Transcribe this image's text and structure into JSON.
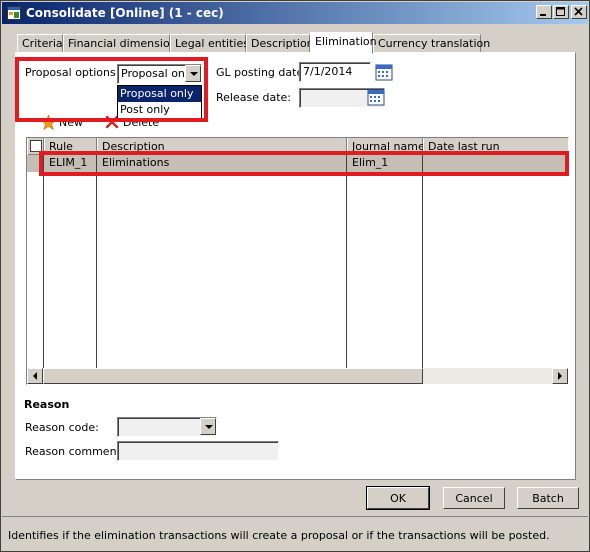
{
  "window": {
    "title": "Consolidate [Online] (1 - cec)",
    "icons": {
      "app": "app-window-icon",
      "minimize": "minimize-icon",
      "maximize": "maximize-icon",
      "close": "close-icon"
    }
  },
  "tabs": [
    {
      "label": "Criteria",
      "active": false
    },
    {
      "label": "Financial dimensions",
      "active": false
    },
    {
      "label": "Legal entities",
      "active": false
    },
    {
      "label": "Description",
      "active": false
    },
    {
      "label": "Elimination",
      "active": true
    },
    {
      "label": "Currency translation",
      "active": false
    }
  ],
  "elimination": {
    "proposal_options_label": "Proposal options:",
    "proposal_options_value": "Proposal only",
    "proposal_options_list": [
      {
        "label": "Proposal only",
        "selected": true
      },
      {
        "label": "Post only",
        "selected": false
      }
    ],
    "gl_posting_date_label": "GL posting date:",
    "gl_posting_date_value": "7/1/2014",
    "release_date_label": "Release date:",
    "release_date_value": ""
  },
  "toolbar": {
    "new_label": "New",
    "delete_label": "Delete"
  },
  "grid": {
    "columns": [
      "Rule",
      "Description",
      "Journal name",
      "Date last run"
    ],
    "rows": [
      {
        "rule": "ELIM_1",
        "description": "Eliminations",
        "journal_name": "Elim_1",
        "date_last_run": ""
      }
    ]
  },
  "reason": {
    "title": "Reason",
    "code_label": "Reason code:",
    "code_value": "",
    "comment_label": "Reason comment:",
    "comment_value": ""
  },
  "buttons": {
    "ok": "OK",
    "cancel": "Cancel",
    "batch": "Batch"
  },
  "status": {
    "text": "Identifies if the elimination transactions will create a proposal or if the transactions will be posted."
  },
  "colors": {
    "highlight": "#e11b22",
    "selected_row": "#c5beb4",
    "titlebar_start": "#08246b",
    "titlebar_end": "#a5caef",
    "list_selection": "#0a246a"
  }
}
